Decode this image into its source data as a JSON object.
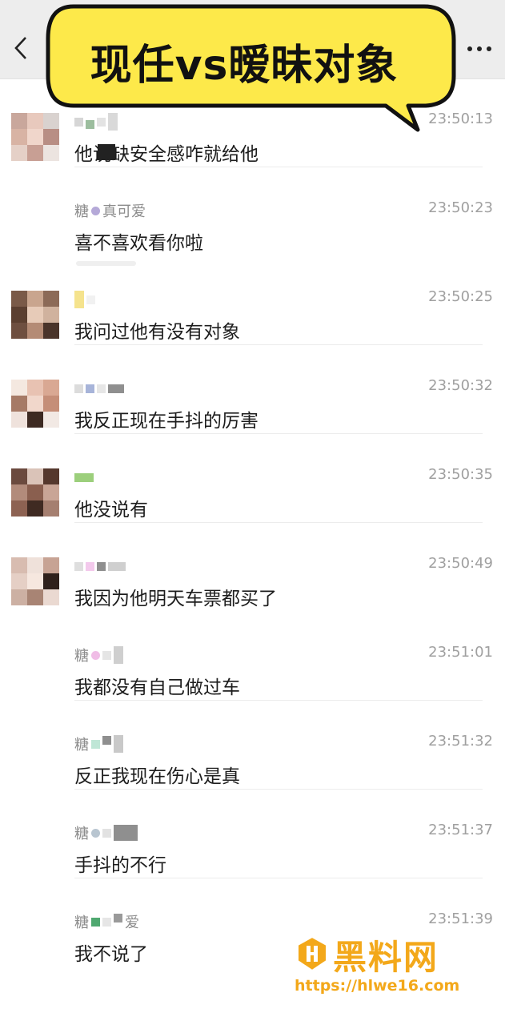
{
  "title_overlay": "现任vs暧昧对象",
  "header": {
    "back_icon": "chevron-left-icon",
    "more_icon": "more-dots-icon"
  },
  "messages": [
    {
      "sender": "",
      "time": "23:50:13",
      "text": "他说缺安全感咋就给他"
    },
    {
      "sender": "糖",
      "sender_suffix": "真可爱",
      "time": "23:50:23",
      "text": "喜不喜欢看你啦"
    },
    {
      "sender": "",
      "time": "23:50:25",
      "text": "我问过他有没有对象"
    },
    {
      "sender": "",
      "time": "23:50:32",
      "text": "我反正现在手抖的厉害"
    },
    {
      "sender": "",
      "time": "23:50:35",
      "text": "他没说有"
    },
    {
      "sender": "",
      "time": "23:50:49",
      "text": "我因为他明天车票都买了"
    },
    {
      "sender": "糖",
      "time": "23:51:01",
      "text": "我都没有自己做过车"
    },
    {
      "sender": "糖",
      "time": "23:51:32",
      "text": "反正我现在伤心是真"
    },
    {
      "sender": "糖",
      "time": "23:51:37",
      "text": "手抖的不行"
    },
    {
      "sender": "糖",
      "sender_suffix": "爱",
      "time": "23:51:39",
      "text": "我不说了"
    }
  ],
  "watermark": {
    "title": "黑料网",
    "url": "https://hlwe16.com"
  },
  "colors": {
    "topbar": "#ededed",
    "bubble": "#fde94a",
    "watermark": "#f3a81a"
  }
}
